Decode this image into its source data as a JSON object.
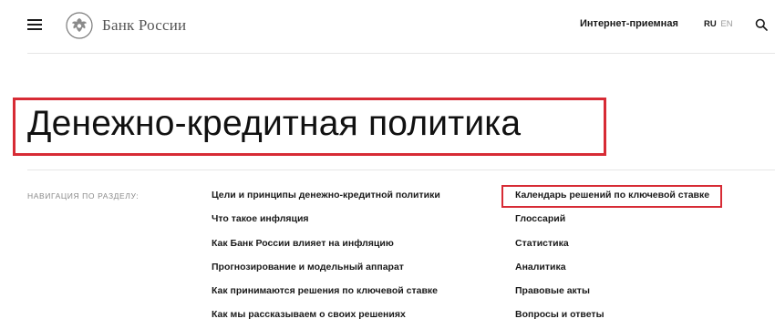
{
  "header": {
    "logo_text": "Банк России",
    "internet_reception": "Интернет-приемная",
    "lang_ru": "RU",
    "lang_en": "EN",
    "icons": {
      "menu": "menu-icon",
      "logo": "eagle-emblem-icon",
      "search": "search-icon"
    }
  },
  "page": {
    "title": "Денежно-кредитная политика"
  },
  "nav": {
    "label": "НАВИГАЦИЯ ПО РАЗДЕЛУ:",
    "col1": [
      "Цели и принципы денежно-кредитной политики",
      "Что такое инфляция",
      "Как Банк России влияет на инфляцию",
      "Прогнозирование и модельный аппарат",
      "Как принимаются решения по ключевой ставке",
      "Как мы рассказываем о своих решениях"
    ],
    "col2": [
      "Календарь решений по ключевой ставке",
      "Глоссарий",
      "Статистика",
      "Аналитика",
      "Правовые акты",
      "Вопросы и ответы"
    ]
  },
  "colors": {
    "highlight": "#d72b35",
    "text": "#1a1a1a",
    "muted": "#8a8a8a",
    "divider": "#e6e6e6"
  }
}
